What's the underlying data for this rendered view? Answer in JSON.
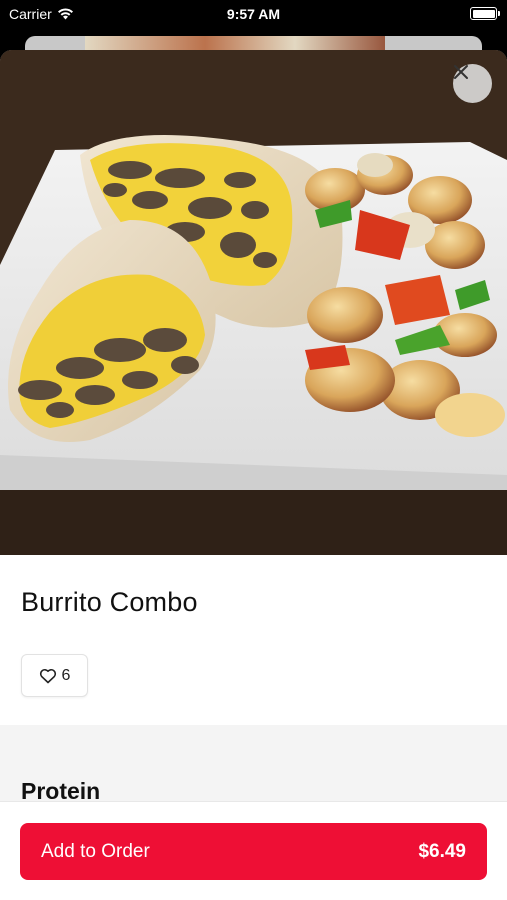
{
  "status_bar": {
    "carrier": "Carrier",
    "time": "9:57 AM"
  },
  "item": {
    "title": "Burrito Combo",
    "likes": "6"
  },
  "sections": {
    "first_title": "Protein"
  },
  "footer": {
    "add_label": "Add to Order",
    "price": "$6.49"
  },
  "colors": {
    "accent": "#ee0f35"
  },
  "icons": {
    "close": "close-icon",
    "heart": "heart-icon",
    "wifi": "wifi-icon",
    "battery": "battery-icon"
  }
}
